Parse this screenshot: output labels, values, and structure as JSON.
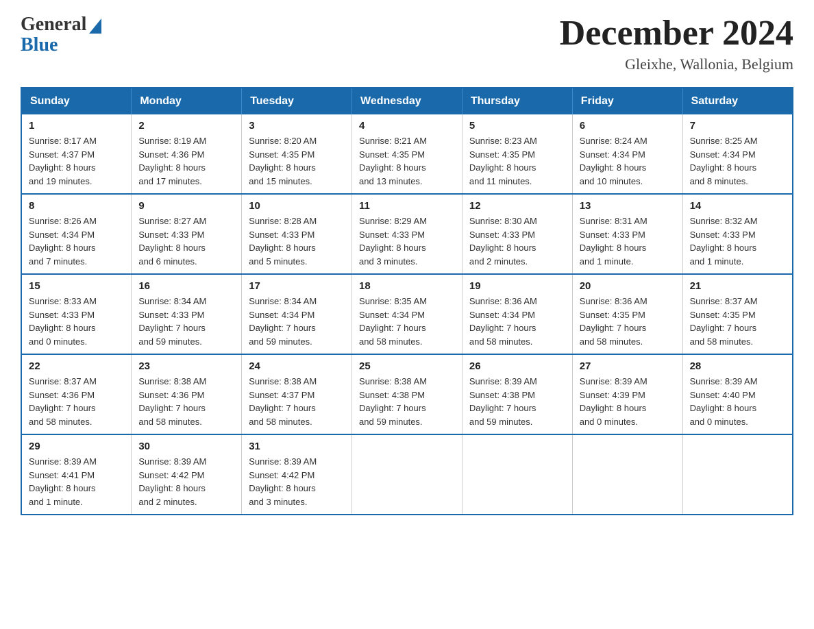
{
  "logo": {
    "general": "General",
    "blue": "Blue"
  },
  "title": "December 2024",
  "location": "Gleixhe, Wallonia, Belgium",
  "days_of_week": [
    "Sunday",
    "Monday",
    "Tuesday",
    "Wednesday",
    "Thursday",
    "Friday",
    "Saturday"
  ],
  "weeks": [
    [
      {
        "day": "1",
        "sunrise": "8:17 AM",
        "sunset": "4:37 PM",
        "daylight": "8 hours and 19 minutes."
      },
      {
        "day": "2",
        "sunrise": "8:19 AM",
        "sunset": "4:36 PM",
        "daylight": "8 hours and 17 minutes."
      },
      {
        "day": "3",
        "sunrise": "8:20 AM",
        "sunset": "4:35 PM",
        "daylight": "8 hours and 15 minutes."
      },
      {
        "day": "4",
        "sunrise": "8:21 AM",
        "sunset": "4:35 PM",
        "daylight": "8 hours and 13 minutes."
      },
      {
        "day": "5",
        "sunrise": "8:23 AM",
        "sunset": "4:35 PM",
        "daylight": "8 hours and 11 minutes."
      },
      {
        "day": "6",
        "sunrise": "8:24 AM",
        "sunset": "4:34 PM",
        "daylight": "8 hours and 10 minutes."
      },
      {
        "day": "7",
        "sunrise": "8:25 AM",
        "sunset": "4:34 PM",
        "daylight": "8 hours and 8 minutes."
      }
    ],
    [
      {
        "day": "8",
        "sunrise": "8:26 AM",
        "sunset": "4:34 PM",
        "daylight": "8 hours and 7 minutes."
      },
      {
        "day": "9",
        "sunrise": "8:27 AM",
        "sunset": "4:33 PM",
        "daylight": "8 hours and 6 minutes."
      },
      {
        "day": "10",
        "sunrise": "8:28 AM",
        "sunset": "4:33 PM",
        "daylight": "8 hours and 5 minutes."
      },
      {
        "day": "11",
        "sunrise": "8:29 AM",
        "sunset": "4:33 PM",
        "daylight": "8 hours and 3 minutes."
      },
      {
        "day": "12",
        "sunrise": "8:30 AM",
        "sunset": "4:33 PM",
        "daylight": "8 hours and 2 minutes."
      },
      {
        "day": "13",
        "sunrise": "8:31 AM",
        "sunset": "4:33 PM",
        "daylight": "8 hours and 1 minute."
      },
      {
        "day": "14",
        "sunrise": "8:32 AM",
        "sunset": "4:33 PM",
        "daylight": "8 hours and 1 minute."
      }
    ],
    [
      {
        "day": "15",
        "sunrise": "8:33 AM",
        "sunset": "4:33 PM",
        "daylight": "8 hours and 0 minutes."
      },
      {
        "day": "16",
        "sunrise": "8:34 AM",
        "sunset": "4:33 PM",
        "daylight": "7 hours and 59 minutes."
      },
      {
        "day": "17",
        "sunrise": "8:34 AM",
        "sunset": "4:34 PM",
        "daylight": "7 hours and 59 minutes."
      },
      {
        "day": "18",
        "sunrise": "8:35 AM",
        "sunset": "4:34 PM",
        "daylight": "7 hours and 58 minutes."
      },
      {
        "day": "19",
        "sunrise": "8:36 AM",
        "sunset": "4:34 PM",
        "daylight": "7 hours and 58 minutes."
      },
      {
        "day": "20",
        "sunrise": "8:36 AM",
        "sunset": "4:35 PM",
        "daylight": "7 hours and 58 minutes."
      },
      {
        "day": "21",
        "sunrise": "8:37 AM",
        "sunset": "4:35 PM",
        "daylight": "7 hours and 58 minutes."
      }
    ],
    [
      {
        "day": "22",
        "sunrise": "8:37 AM",
        "sunset": "4:36 PM",
        "daylight": "7 hours and 58 minutes."
      },
      {
        "day": "23",
        "sunrise": "8:38 AM",
        "sunset": "4:36 PM",
        "daylight": "7 hours and 58 minutes."
      },
      {
        "day": "24",
        "sunrise": "8:38 AM",
        "sunset": "4:37 PM",
        "daylight": "7 hours and 58 minutes."
      },
      {
        "day": "25",
        "sunrise": "8:38 AM",
        "sunset": "4:38 PM",
        "daylight": "7 hours and 59 minutes."
      },
      {
        "day": "26",
        "sunrise": "8:39 AM",
        "sunset": "4:38 PM",
        "daylight": "7 hours and 59 minutes."
      },
      {
        "day": "27",
        "sunrise": "8:39 AM",
        "sunset": "4:39 PM",
        "daylight": "8 hours and 0 minutes."
      },
      {
        "day": "28",
        "sunrise": "8:39 AM",
        "sunset": "4:40 PM",
        "daylight": "8 hours and 0 minutes."
      }
    ],
    [
      {
        "day": "29",
        "sunrise": "8:39 AM",
        "sunset": "4:41 PM",
        "daylight": "8 hours and 1 minute."
      },
      {
        "day": "30",
        "sunrise": "8:39 AM",
        "sunset": "4:42 PM",
        "daylight": "8 hours and 2 minutes."
      },
      {
        "day": "31",
        "sunrise": "8:39 AM",
        "sunset": "4:42 PM",
        "daylight": "8 hours and 3 minutes."
      },
      null,
      null,
      null,
      null
    ]
  ],
  "labels": {
    "sunrise": "Sunrise:",
    "sunset": "Sunset:",
    "daylight": "Daylight:"
  }
}
